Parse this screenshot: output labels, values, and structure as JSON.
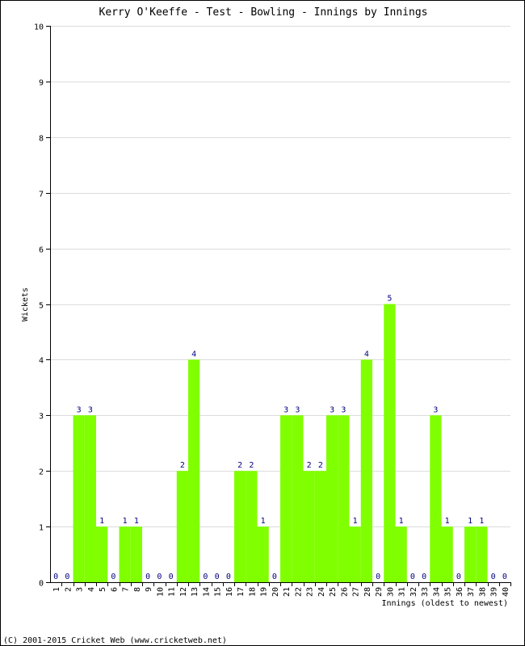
{
  "chart_data": {
    "type": "bar",
    "title": "Kerry O'Keeffe - Test - Bowling - Innings by Innings",
    "xlabel": "Innings (oldest to newest)",
    "ylabel": "Wickets",
    "ylim": [
      0,
      10
    ],
    "yticks": [
      0,
      1,
      2,
      3,
      4,
      5,
      6,
      7,
      8,
      9,
      10
    ],
    "grid": true,
    "categories": [
      "1",
      "2",
      "3",
      "4",
      "5",
      "6",
      "7",
      "8",
      "9",
      "10",
      "11",
      "12",
      "13",
      "14",
      "15",
      "16",
      "17",
      "18",
      "19",
      "20",
      "21",
      "22",
      "23",
      "24",
      "25",
      "26",
      "27",
      "28",
      "29",
      "30",
      "31",
      "32",
      "33",
      "34",
      "35",
      "36",
      "37",
      "38",
      "39",
      "40"
    ],
    "values": [
      0,
      0,
      3,
      3,
      1,
      0,
      1,
      1,
      0,
      0,
      0,
      2,
      4,
      0,
      0,
      0,
      2,
      2,
      1,
      0,
      3,
      3,
      2,
      2,
      3,
      3,
      1,
      4,
      0,
      5,
      1,
      0,
      0,
      3,
      1,
      0,
      1,
      1,
      0,
      0
    ],
    "bar_color": "#80ff00",
    "label_color": "#000080",
    "grid_color": "#dcdcdc"
  },
  "footer": "(C) 2001-2015 Cricket Web (www.cricketweb.net)"
}
